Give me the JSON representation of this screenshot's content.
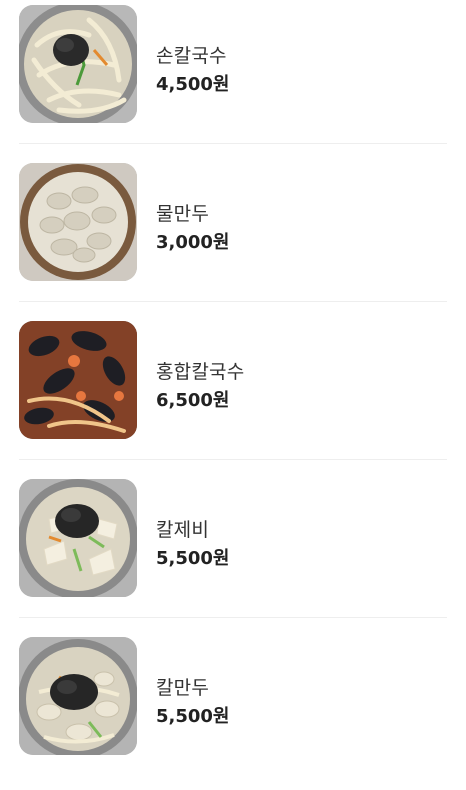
{
  "menu": {
    "items": [
      {
        "name": "손칼국수",
        "price": "4,500원",
        "image": "handmade-kalguksu-photo"
      },
      {
        "name": "물만두",
        "price": "3,000원",
        "image": "boiled-dumplings-photo"
      },
      {
        "name": "홍합칼국수",
        "price": "6,500원",
        "image": "mussel-kalguksu-photo"
      },
      {
        "name": "칼제비",
        "price": "5,500원",
        "image": "kaljebi-photo"
      },
      {
        "name": "칼만두",
        "price": "5,500원",
        "image": "kal-mandu-photo"
      }
    ]
  },
  "colors": {
    "divider": "#eeeeee",
    "name_text": "#333333",
    "price_text": "#222222"
  }
}
